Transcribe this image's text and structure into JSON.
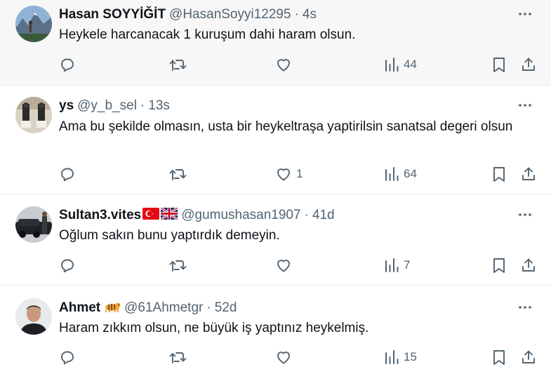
{
  "tweets": [
    {
      "name": "Hasan SOYYİĞİT",
      "handle": "@HasanSoyyi12295",
      "separator": "·",
      "time": "4s",
      "text": "Heykele harcanacak 1 kuruşum dahi haram olsun.",
      "likes": "",
      "views": "44"
    },
    {
      "name": "ys",
      "handle": "@y_b_sel",
      "separator": "·",
      "time": "13s",
      "text": "Ama bu şekilde olmasın, usta bir heykeltraşa yaptirilsin sanatsal degeri olsun",
      "likes": "1",
      "views": "64"
    },
    {
      "name": "Sultan3.vites",
      "handle": "@gumushasan1907",
      "separator": "·",
      "time": "41d",
      "text": "Oğlum sakın bunu yaptırdık demeyin.",
      "likes": "",
      "views": "7"
    },
    {
      "name": "Ahmet",
      "handle": "@61Ahmetgr",
      "separator": "·",
      "time": "52d",
      "text": "Haram zıkkım olsun, ne büyük iş yaptınız heykelmiş.",
      "likes": "",
      "views": "15"
    }
  ],
  "icons": {
    "more": "more-dots-icon",
    "reply": "reply-icon",
    "retweet": "retweet-icon",
    "like": "heart-icon",
    "views": "views-chart-icon",
    "bookmark": "bookmark-icon",
    "share": "share-icon",
    "flags": [
      "turkey-flag-icon",
      "uk-flag-icon"
    ],
    "emoji": "tiger-emoji-icon"
  },
  "colors": {
    "text": "#0f1419",
    "secondary": "#536471",
    "divider": "#e6e9eb",
    "highlight_bg": "#f7f7f7"
  }
}
